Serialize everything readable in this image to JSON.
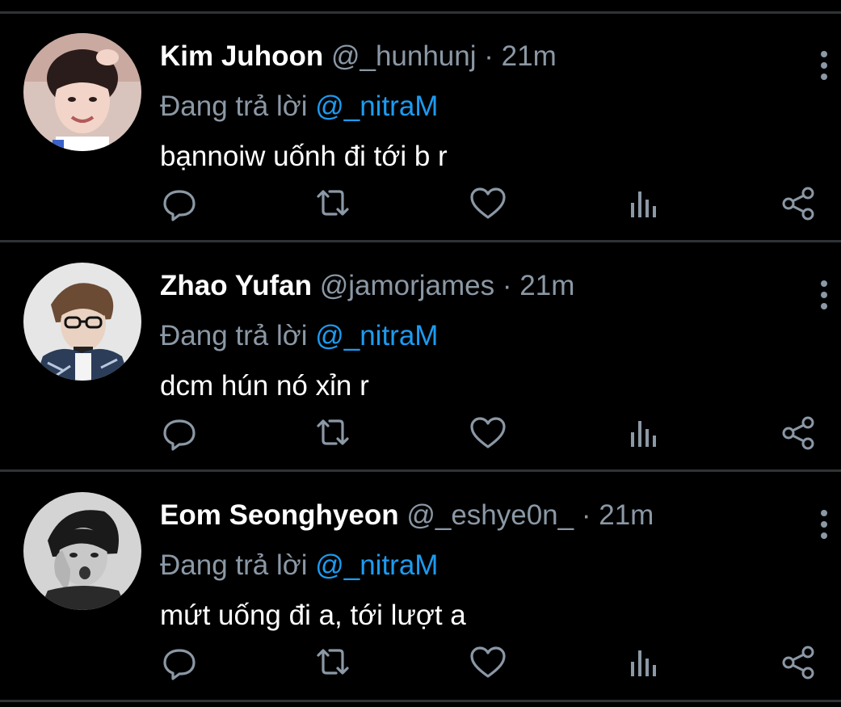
{
  "colors": {
    "background": "#000000",
    "divider": "#2f3336",
    "text_primary": "#ffffff",
    "text_secondary": "#8b98a5",
    "accent": "#1d9bf0"
  },
  "tweets": [
    {
      "name": "Kim Juhoon",
      "handle": "@_hunhunj",
      "separator": "·",
      "time": "21m",
      "reply_prefix": "Đang trả lời",
      "reply_to": "@_nitraM",
      "text": "bạnnoiw uốnh đi tới b r",
      "icons": [
        "more-vertical-icon",
        "reply-icon",
        "retweet-icon",
        "like-icon",
        "views-icon",
        "share-icon"
      ]
    },
    {
      "name": "Zhao Yufan",
      "handle": "@jamorjames",
      "separator": "·",
      "time": "21m",
      "reply_prefix": "Đang trả lời",
      "reply_to": "@_nitraM",
      "text": "dcm hún nó xỉn r",
      "icons": [
        "more-vertical-icon",
        "reply-icon",
        "retweet-icon",
        "like-icon",
        "views-icon",
        "share-icon"
      ]
    },
    {
      "name": "Eom Seonghyeon",
      "handle": "@_eshye0n_",
      "separator": "·",
      "time": "21m",
      "reply_prefix": "Đang trả lời",
      "reply_to": "@_nitraM",
      "text": "mứt uống đi a, tới lượt a",
      "icons": [
        "more-vertical-icon",
        "reply-icon",
        "retweet-icon",
        "like-icon",
        "views-icon",
        "share-icon"
      ]
    }
  ]
}
